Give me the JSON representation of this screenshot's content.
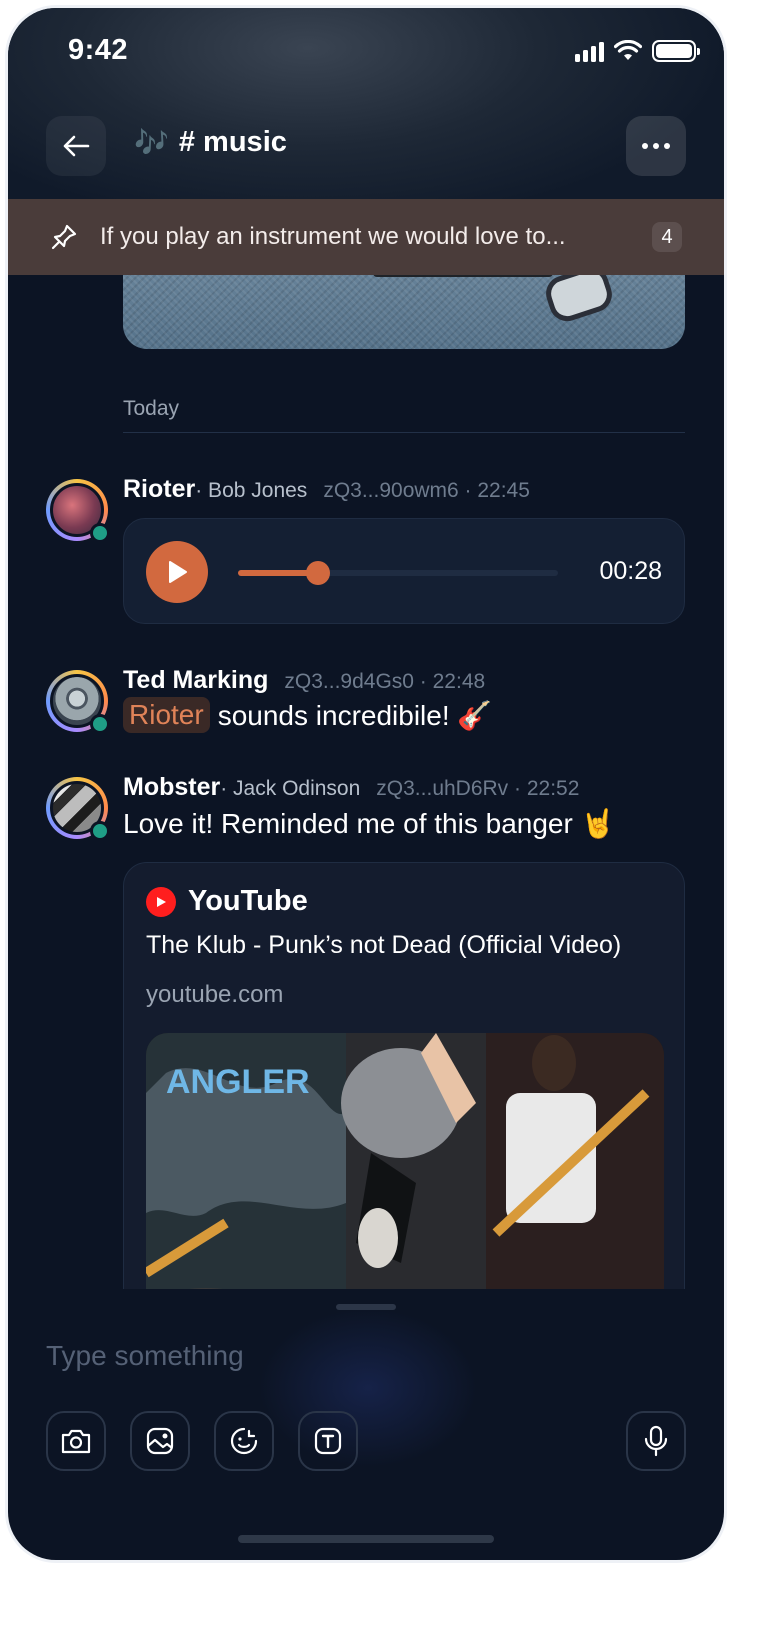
{
  "status_bar": {
    "time": "9:42"
  },
  "header": {
    "channel_emoji": "🎶",
    "channel_name": "# music",
    "back_icon": "arrow-left-icon",
    "more_icon": "more-horizontal-icon"
  },
  "pinned": {
    "icon": "pin-icon",
    "text": "If you play an instrument we would love to...",
    "count": "4"
  },
  "feed": {
    "day_label": "Today",
    "messages": [
      {
        "user": "Rioter",
        "subname": " · Bob Jones",
        "meta": "zQ3...90owm6 · 22:45",
        "audio": {
          "duration": "00:28",
          "progress": 0.25
        }
      },
      {
        "user": "Ted Marking",
        "meta": "zQ3...9d4Gs0 · 22:48",
        "mention": "Rioter",
        "text": "sounds incredibile! 🎸"
      },
      {
        "user": "Mobster",
        "subname": " · Jack Odinson",
        "meta": "zQ3...uhD6Rv · 22:52",
        "text": "Love it! Reminded me of this banger 🤘",
        "link": {
          "source": "YouTube",
          "title": "The Klub - Punk’s not Dead (Official Video)",
          "domain": "youtube.com"
        }
      }
    ]
  },
  "composer": {
    "placeholder": "Type something",
    "tools": [
      "camera-icon",
      "image-icon",
      "sticker-icon",
      "text-format-icon"
    ],
    "mic_icon": "microphone-icon"
  },
  "colors": {
    "accent": "#d2693f",
    "background": "#0c1424",
    "pinned_bg": "#4a3c3a",
    "online": "#1f9e86",
    "youtube": "#ff1e1e"
  }
}
